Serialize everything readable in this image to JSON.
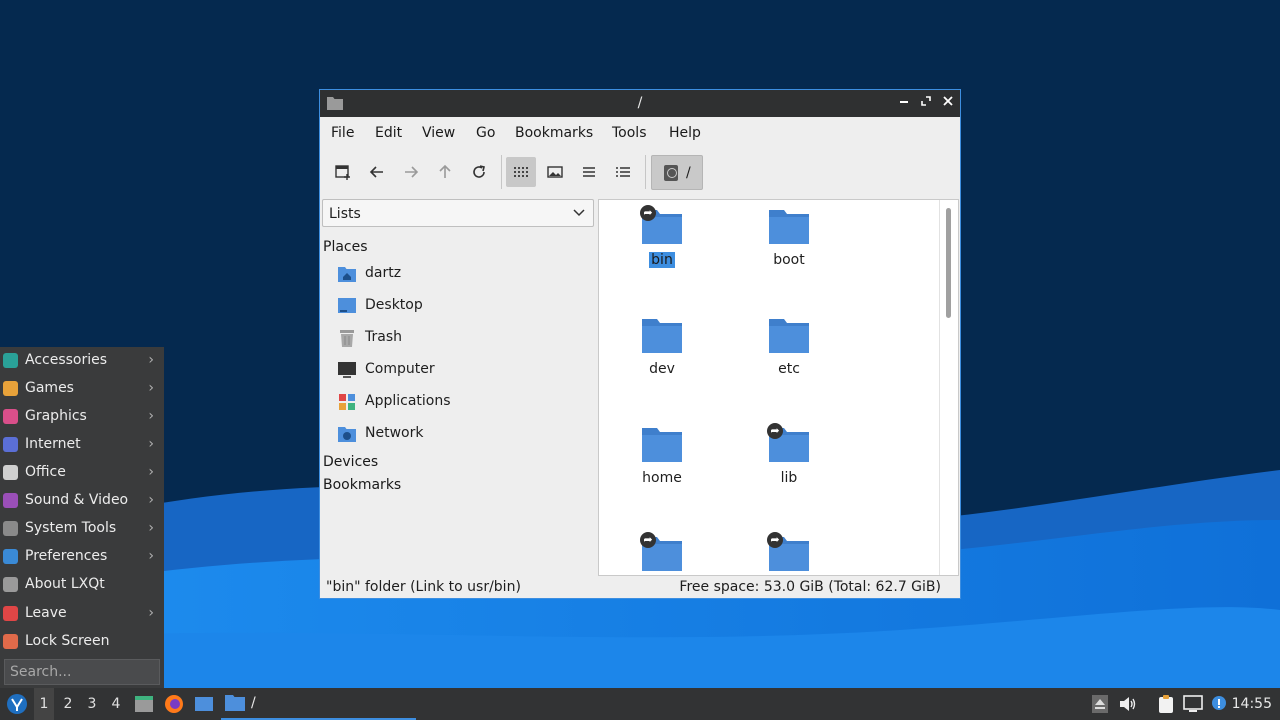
{
  "window": {
    "title": "/",
    "menus": [
      "File",
      "Edit",
      "View",
      "Go",
      "Bookmarks",
      "Tools",
      "Help"
    ],
    "path": "/"
  },
  "side_pane": {
    "mode": "Lists",
    "places_header": "Places",
    "places": [
      "dartz",
      "Desktop",
      "Trash",
      "Computer",
      "Applications",
      "Network"
    ],
    "devices_header": "Devices",
    "bookmarks_header": "Bookmarks"
  },
  "files": [
    {
      "name": "bin",
      "link": true,
      "selected": true
    },
    {
      "name": "boot",
      "link": false,
      "selected": false
    },
    {
      "name": "dev",
      "link": false,
      "selected": false
    },
    {
      "name": "etc",
      "link": false,
      "selected": false
    },
    {
      "name": "home",
      "link": false,
      "selected": false
    },
    {
      "name": "lib",
      "link": true,
      "selected": false
    },
    {
      "name": "",
      "link": true,
      "selected": false
    },
    {
      "name": "",
      "link": true,
      "selected": false
    }
  ],
  "status": {
    "selection": "\"bin\" folder (Link to usr/bin)",
    "free_space": "Free space: 53.0 GiB (Total: 62.7 GiB)"
  },
  "start_menu": {
    "items": [
      {
        "label": "Accessories",
        "submenu": true,
        "icon": "accessories-icon",
        "color": "#2aa198"
      },
      {
        "label": "Games",
        "submenu": true,
        "icon": "games-icon",
        "color": "#e8a23a"
      },
      {
        "label": "Graphics",
        "submenu": true,
        "icon": "graphics-icon",
        "color": "#d94f8a"
      },
      {
        "label": "Internet",
        "submenu": true,
        "icon": "internet-icon",
        "color": "#5b6fd6"
      },
      {
        "label": "Office",
        "submenu": true,
        "icon": "office-icon",
        "color": "#cfcfcf"
      },
      {
        "label": "Sound & Video",
        "submenu": true,
        "icon": "sound-video-icon",
        "color": "#9a4fb8"
      },
      {
        "label": "System Tools",
        "submenu": true,
        "icon": "system-tools-icon",
        "color": "#8a8a8a"
      },
      {
        "label": "Preferences",
        "submenu": true,
        "icon": "preferences-icon",
        "color": "#3a8ad6"
      },
      {
        "label": "About LXQt",
        "submenu": false,
        "icon": "info-icon",
        "color": "#9a9a9a"
      },
      {
        "label": "Leave",
        "submenu": true,
        "icon": "power-icon",
        "color": "#e04646"
      },
      {
        "label": "Lock Screen",
        "submenu": false,
        "icon": "lock-icon",
        "color": "#e06a4a"
      }
    ],
    "search_placeholder": "Search..."
  },
  "taskbar": {
    "desktops": [
      "1",
      "2",
      "3",
      "4"
    ],
    "task_label": "/",
    "clock": "14:55"
  },
  "colors": {
    "accent": "#3d8ee0",
    "folder": "#4d8fdc",
    "desktop_dark": "#052a52"
  }
}
